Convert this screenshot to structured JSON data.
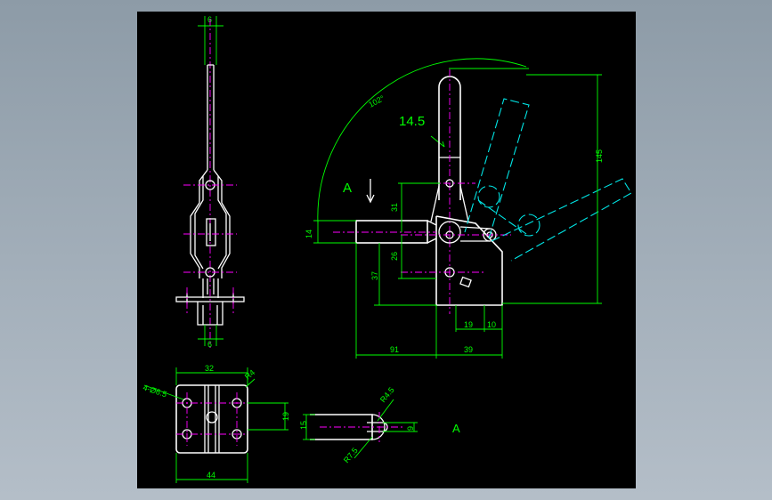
{
  "drawing": {
    "colors": {
      "background": "#000000",
      "outline": "#ffffff",
      "dimension": "#00ff00",
      "center_line": "#ff00ff",
      "phantom": "#00e5e5"
    },
    "side_view": {
      "top_width": "6",
      "bottom_width": "6"
    },
    "main_view": {
      "angle": "102°",
      "handle_dim": "14.5",
      "section_label": "A",
      "overall_height": "145",
      "dim_31": "31",
      "dim_26": "26",
      "dim_37": "37",
      "dim_14": "14",
      "dim_91": "91",
      "dim_39": "39",
      "dim_19": "19",
      "dim_10": "10"
    },
    "base_view": {
      "width_top": "32",
      "width_bottom": "44",
      "hole_spec": "4-Ø6.5",
      "corner_radius": "R4",
      "slot_height": "19"
    },
    "detail_a": {
      "label": "A",
      "radius_top": "R4.5",
      "radius_bottom": "R7.5",
      "height_left": "15",
      "height_right": "9"
    }
  }
}
